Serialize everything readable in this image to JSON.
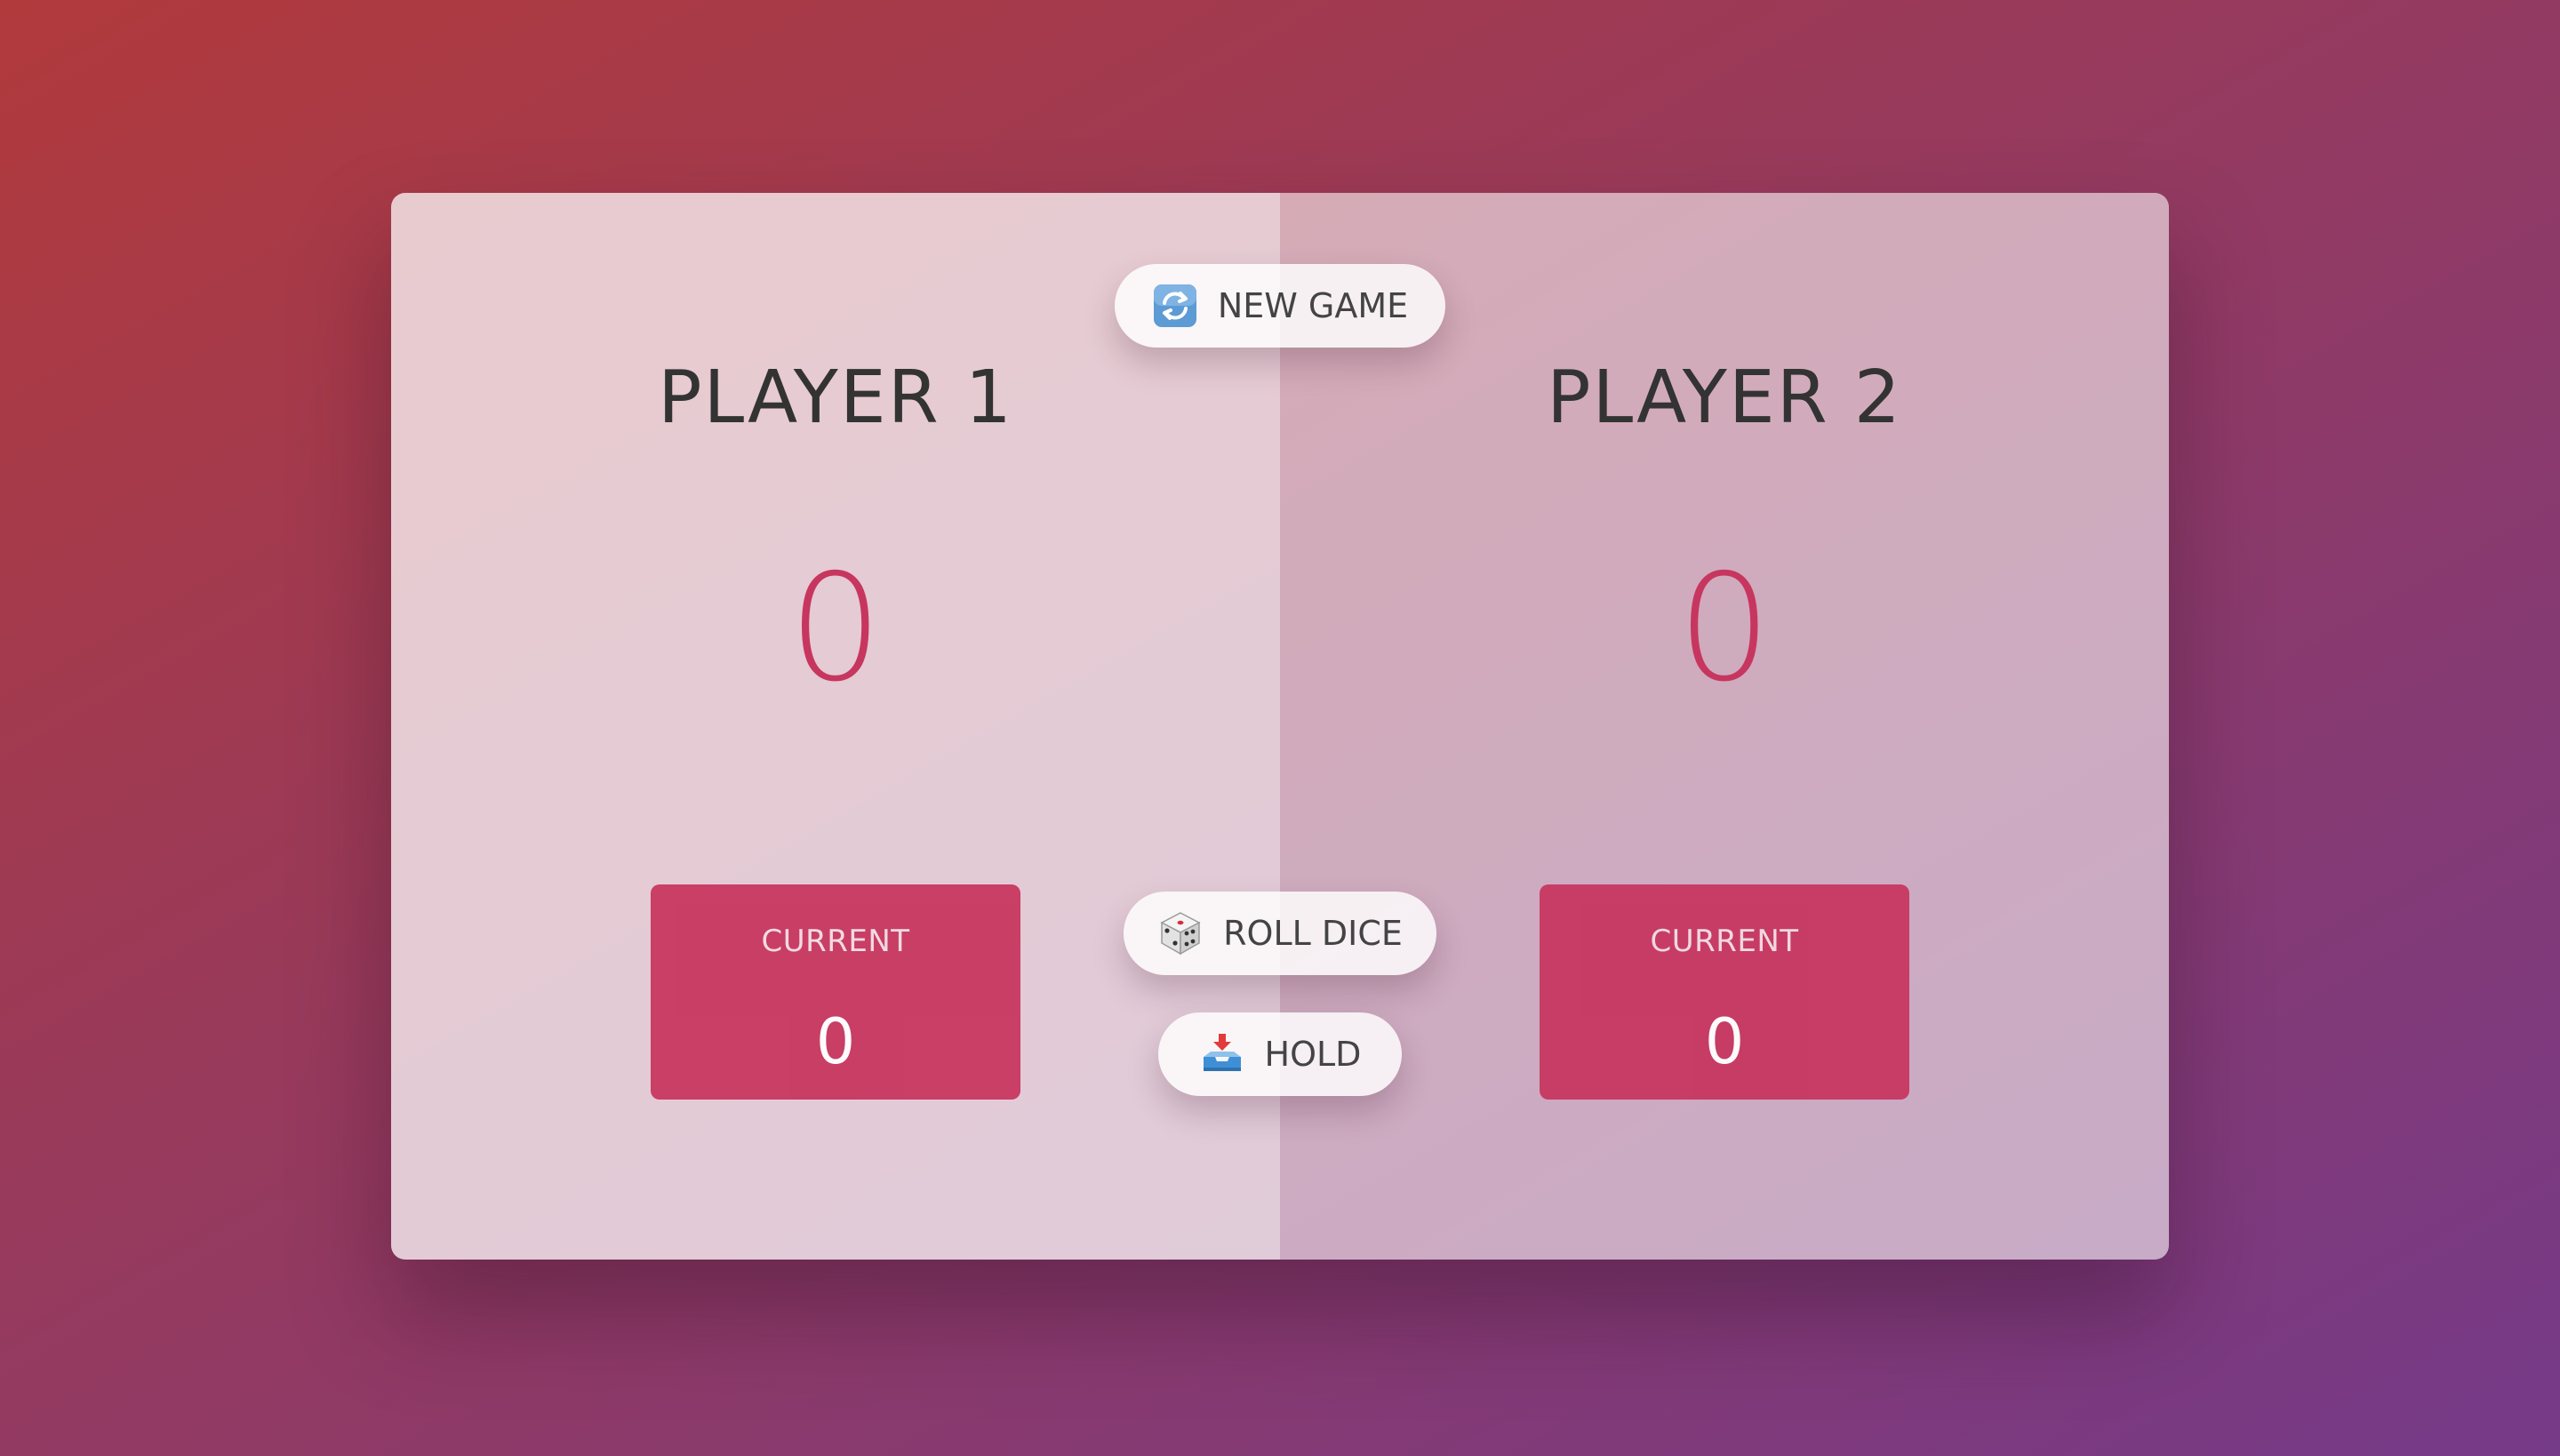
{
  "buttons": {
    "new_game": {
      "label": "NEW GAME",
      "icon": "refresh-icon"
    },
    "roll_dice": {
      "label": "ROLL DICE",
      "icon": "dice-icon"
    },
    "hold": {
      "label": "HOLD",
      "icon": "inbox-tray-icon"
    }
  },
  "players": [
    {
      "name": "PLAYER 1",
      "score": "0",
      "current_label": "CURRENT",
      "current_score": "0",
      "active": true
    },
    {
      "name": "PLAYER 2",
      "score": "0",
      "current_label": "CURRENT",
      "current_score": "0",
      "active": false
    }
  ],
  "colors": {
    "accent": "#c7365f",
    "background_gradient_start": "#b13a3c",
    "background_gradient_end": "#753a88",
    "text": "#333333"
  }
}
